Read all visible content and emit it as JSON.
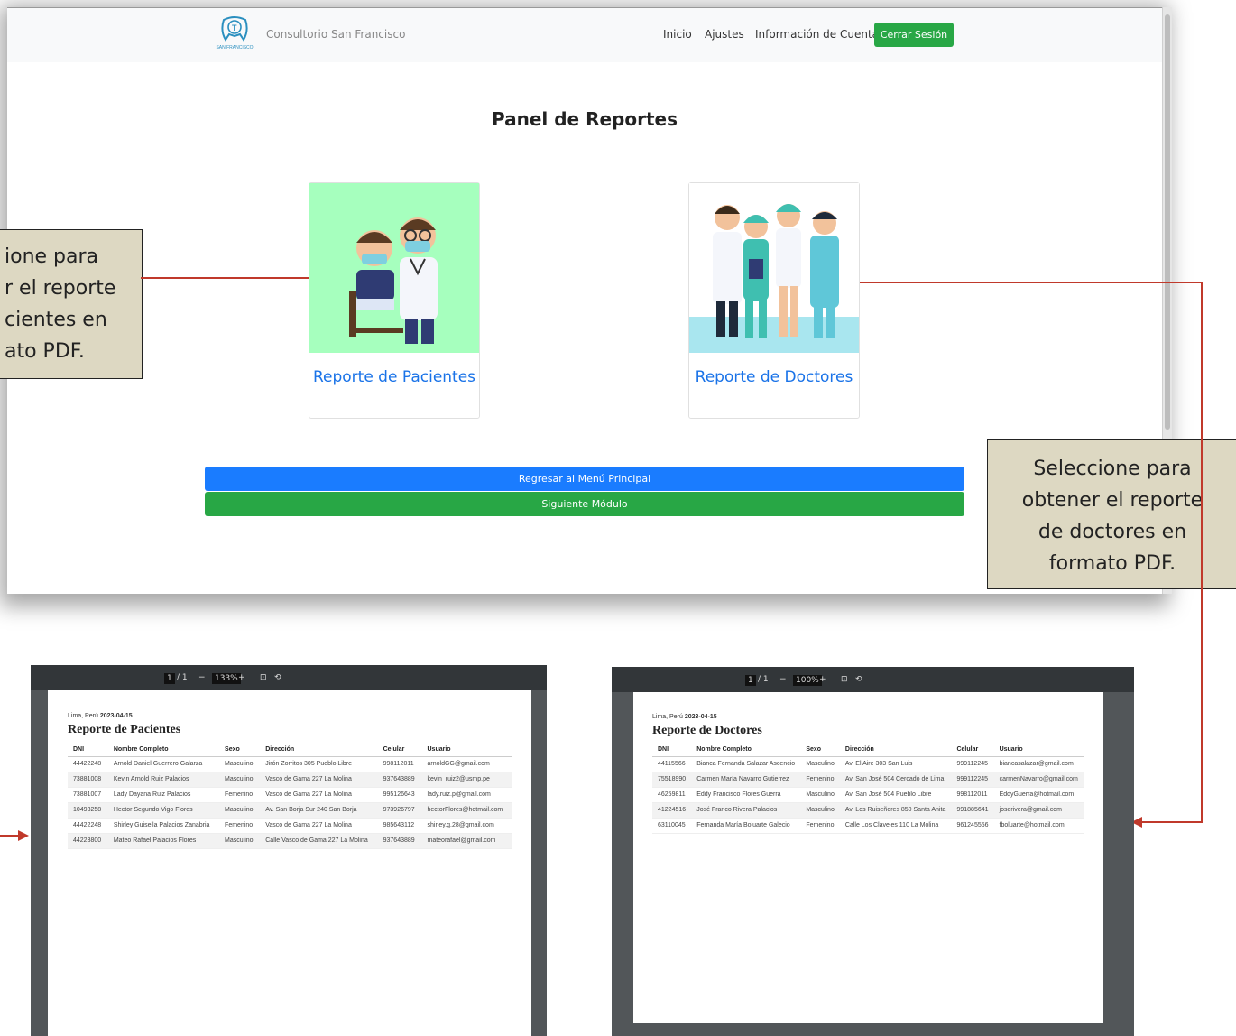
{
  "navbar": {
    "brand": "Consultorio San Francisco",
    "logo_text": "SAN FRANCISCO",
    "links": [
      "Inicio",
      "Ajustes",
      "Información de Cuenta"
    ],
    "logout_label": "Cerrar Sesión"
  },
  "main": {
    "title": "Panel de Reportes",
    "card_patients": "Reporte de Pacientes",
    "card_doctors": "Reporte de Doctores",
    "back_button": "Regresar al Menú Principal",
    "next_button": "Siguiente Módulo"
  },
  "callouts": {
    "left": [
      "ione para",
      "r el reporte",
      "cientes en",
      "ato PDF."
    ],
    "right": [
      "Seleccione para",
      "obtener el reporte",
      "de doctores en",
      "formato PDF."
    ]
  },
  "pdf_patients": {
    "toolbar": {
      "page": "1",
      "total": "/ 1",
      "zoom": "133%"
    },
    "place": "Lima, Perú",
    "date": "2023-04-15",
    "title": "Reporte de Pacientes",
    "headers": [
      "DNI",
      "Nombre Completo",
      "Sexo",
      "Dirección",
      "Celular",
      "Usuario"
    ],
    "rows": [
      [
        "44422248",
        "Arnold Daniel Guerrero Galarza",
        "Masculino",
        "Jirón Zorritos 305 Pueblo Libre",
        "998112011",
        "arnoldGG@gmail.com"
      ],
      [
        "73881008",
        "Kevin Arnold Ruiz Palacios",
        "Masculino",
        "Vasco de Gama 227 La Molina",
        "937643889",
        "kevin_ruiz2@usmp.pe"
      ],
      [
        "73881007",
        "Lady Dayana Ruiz Palacios",
        "Femenino",
        "Vasco de Gama 227 La Molina",
        "995126643",
        "lady.ruiz.p@gmail.com"
      ],
      [
        "10493258",
        "Hector Segundo Vigo Flores",
        "Masculino",
        "Av. San Borja Sur 240 San Borja",
        "973926797",
        "hectorFlores@hotmail.com"
      ],
      [
        "44422248",
        "Shirley Guisella Palacios Zanabria",
        "Femenino",
        "Vasco de Gama 227 La Molina",
        "985643112",
        "shirley.g.28@gmail.com"
      ],
      [
        "44223800",
        "Mateo Rafael Palacios Flores",
        "Masculino",
        "Calle Vasco de Gama 227 La Molina",
        "937643889",
        "mateorafael@gmail.com"
      ]
    ]
  },
  "pdf_doctors": {
    "toolbar": {
      "page": "1",
      "total": "/ 1",
      "zoom": "100%"
    },
    "place": "Lima, Perú",
    "date": "2023-04-15",
    "title": "Reporte de Doctores",
    "headers": [
      "DNI",
      "Nombre Completo",
      "Sexo",
      "Dirección",
      "Celular",
      "Usuario"
    ],
    "rows": [
      [
        "44115566",
        "Bianca Fernanda Salazar Ascencio",
        "Masculino",
        "Av. El Aire 303 San Luis",
        "999112245",
        "biancasalazar@gmail.com"
      ],
      [
        "75518990",
        "Carmen María Navarro Gutierrez",
        "Femenino",
        "Av. San José 504 Cercado de Lima",
        "999112245",
        "carmenNavarro@gmail.com"
      ],
      [
        "46259811",
        "Eddy Francisco Flores Guerra",
        "Masculino",
        "Av. San José 504 Pueblo Libre",
        "998112011",
        "EddyGuerra@hotmail.com"
      ],
      [
        "41224516",
        "José Franco Rivera Palacios",
        "Masculino",
        "Av. Los Ruiseñores 850 Santa Anita",
        "991885641",
        "joserivera@gmail.com"
      ],
      [
        "63110045",
        "Fernanda María Boluarte Galecio",
        "Femenino",
        "Calle Los Claveles 110 La Molina",
        "961245556",
        "fboluarte@hotmail.com"
      ]
    ]
  },
  "colors": {
    "primary": "#1a7cff",
    "success": "#28a745",
    "callout_bg": "#ddd8c2",
    "connector": "#c0392b",
    "patient_card_bg": "#a6ffbe",
    "doctor_card_bg": "#a9e6ef"
  }
}
